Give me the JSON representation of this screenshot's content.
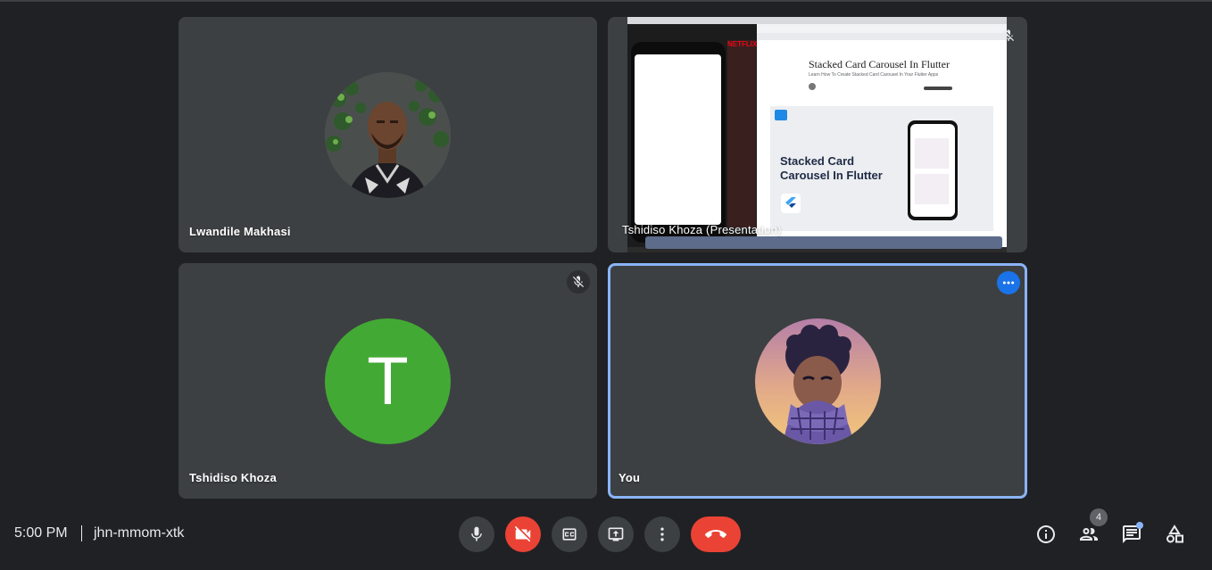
{
  "participants": [
    {
      "name": "Lwandile Makhasi"
    },
    {
      "name": "Tshidiso Khoza (Presentation)"
    },
    {
      "name": "Tshidiso Khoza",
      "initial": "T",
      "avatar_color": "#43a935"
    },
    {
      "name": "You"
    }
  ],
  "presentation": {
    "article_title": "Stacked Card Carousel In Flutter",
    "article_subtitle": "Learn How To Create Stacked Card Carousel In Your Flutter Apps",
    "card_title_line1": "Stacked Card",
    "card_title_line2": "Carousel In Flutter",
    "netflix_text": "NETFLIX"
  },
  "meeting": {
    "time": "5:00 PM",
    "code": "jhn-mmom-xtk",
    "participant_count": "4"
  },
  "colors": {
    "background": "#202124",
    "tile": "#3c4043",
    "accent_blue": "#1a73e8",
    "active_border": "#8ab4f8",
    "danger_red": "#ea4335"
  },
  "icons": {
    "mic": "mic-icon",
    "camera_off": "camera-off-icon",
    "captions": "captions-icon",
    "present": "present-screen-icon",
    "more": "more-options-icon",
    "end_call": "end-call-icon",
    "info": "info-icon",
    "people": "people-icon",
    "chat": "chat-icon",
    "activities": "activities-icon",
    "muted": "mic-off-icon"
  }
}
